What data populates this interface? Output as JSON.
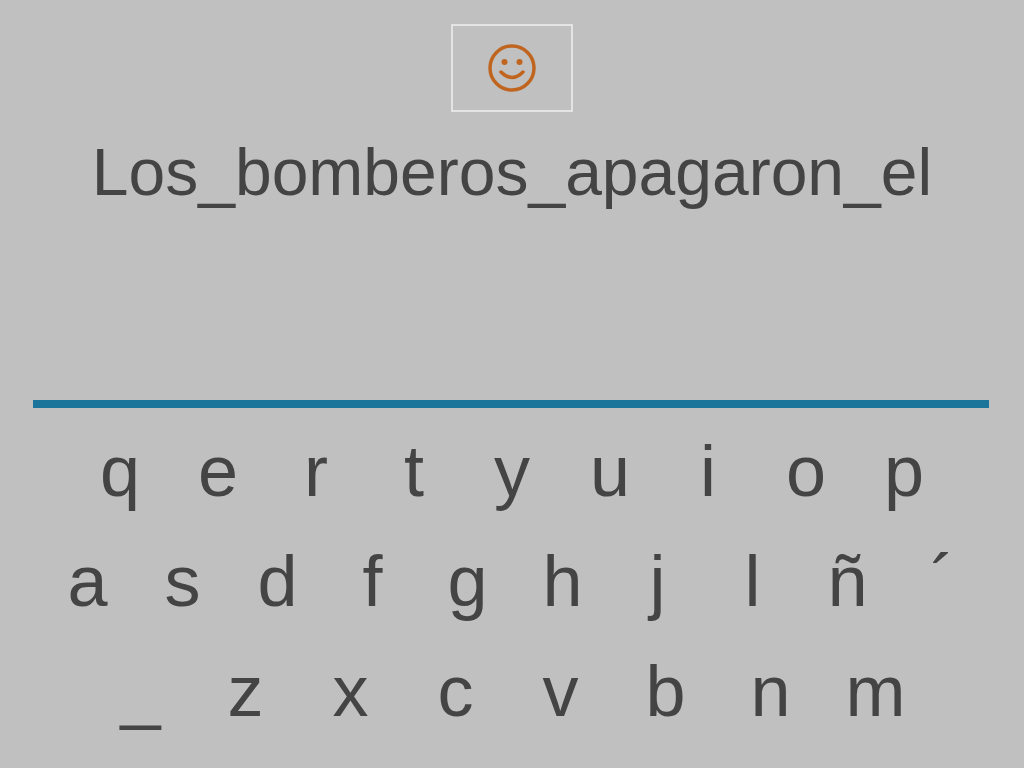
{
  "sentence": "Los_bomberos_apagaron_el",
  "keyboard": {
    "rows": [
      [
        "q",
        "e",
        "r",
        "t",
        "y",
        "u",
        "i",
        "o",
        "p"
      ],
      [
        "a",
        "s",
        "d",
        "f",
        "g",
        "h",
        "j",
        "l",
        "ñ",
        "´"
      ],
      [
        "_",
        "z",
        "x",
        "c",
        "v",
        "b",
        "n",
        "m"
      ]
    ]
  }
}
